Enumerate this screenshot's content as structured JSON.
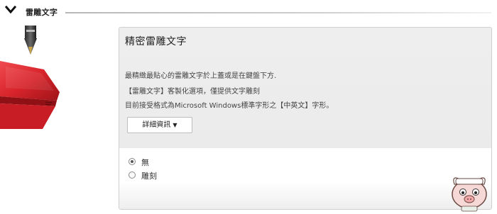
{
  "section": {
    "title": "雷雕文字"
  },
  "panel": {
    "title": "精密雷雕文字",
    "description": [
      "最精緻最貼心的雷雕文字於上蓋或是在鍵盤下方.",
      "【雷雕文字】客製化選項，僅提供文字雕刻",
      "目前接受格式為Microsoft Windows標準字形之【中英文】字形。"
    ],
    "details_button": {
      "label": "詳細資訊",
      "caret": "▼"
    },
    "options": [
      {
        "label": "無",
        "selected": true
      },
      {
        "label": "雕刻",
        "selected": false
      }
    ]
  },
  "icons": {
    "collapse": "chevron-down-icon",
    "tool": "engraving-tool-icon",
    "product": "red-laptop-image",
    "watermark": "pig-mascot-logo"
  },
  "colors": {
    "laptop_red": "#d8242b",
    "panel_bg": "#ececec",
    "border": "#cfcfcf"
  }
}
